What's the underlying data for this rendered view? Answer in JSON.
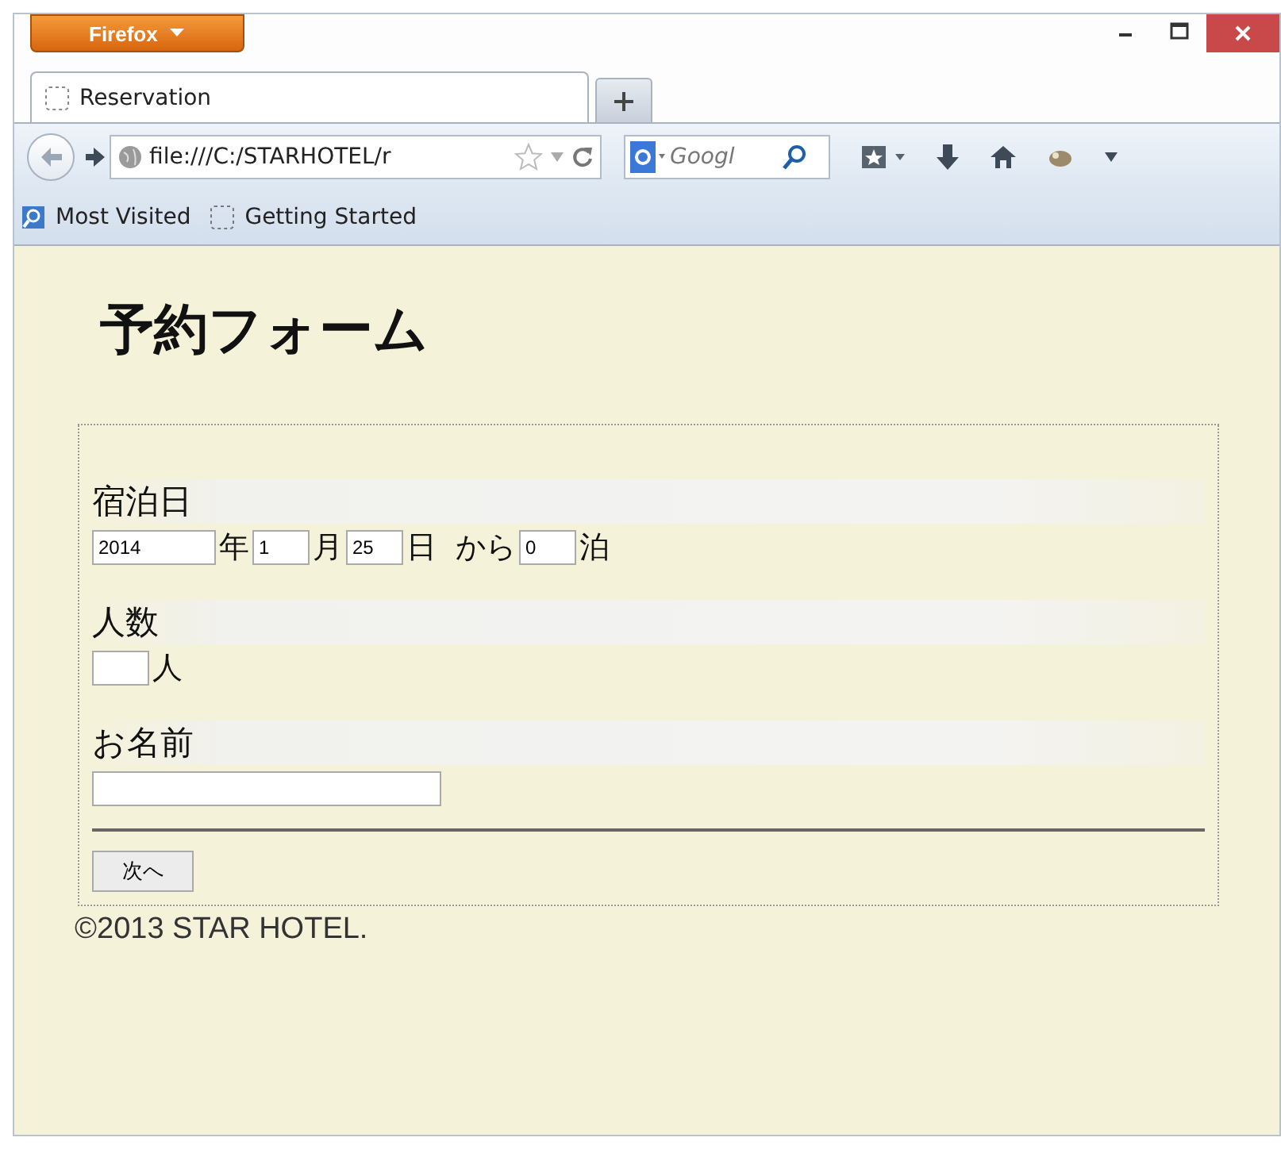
{
  "browser": {
    "menu_button": "Firefox",
    "tabs": [
      {
        "title": "Reservation",
        "selected": true
      }
    ],
    "address": "file:///C:/STARHOTEL/r",
    "search": {
      "placeholder": "Googl"
    },
    "bookmarks": [
      "Most Visited",
      "Getting Started"
    ]
  },
  "page": {
    "heading": "予約フォーム",
    "sections": [
      {
        "label": "宿泊日",
        "items": [
          {
            "kind": "year-input",
            "value": "2014"
          },
          {
            "kind": "text",
            "text": "年"
          },
          {
            "kind": "number-input",
            "value": "1"
          },
          {
            "kind": "text",
            "text": "月"
          },
          {
            "kind": "number-input",
            "value": "25"
          },
          {
            "kind": "text",
            "text": "日"
          },
          {
            "kind": "text",
            "text": "から"
          },
          {
            "kind": "number-input",
            "value": "0"
          },
          {
            "kind": "text",
            "text": "泊"
          }
        ]
      },
      {
        "label": "人数",
        "items": [
          {
            "kind": "number-input"
          },
          {
            "kind": "text",
            "text": "人"
          }
        ]
      },
      {
        "label": "お名前",
        "items": [
          {
            "kind": "name-input"
          }
        ]
      }
    ],
    "button": "次へ",
    "footer": "©2013 STAR HOTEL."
  }
}
